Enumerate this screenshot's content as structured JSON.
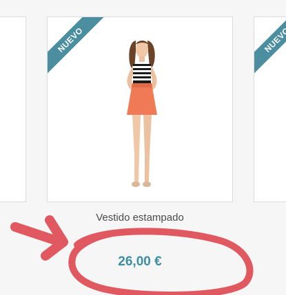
{
  "products": {
    "left": {},
    "center": {
      "badge": "NUEVO",
      "title": "Vestido estampado",
      "price": "26,00 €"
    },
    "right": {
      "badge": "NUEVO"
    }
  },
  "colors": {
    "badge": "#4b8ea0",
    "price": "#3e8ea2",
    "annotation": "#e05860",
    "skirt": "#f07a55"
  },
  "annotation": {
    "shapes": [
      "arrow",
      "ellipse"
    ]
  }
}
